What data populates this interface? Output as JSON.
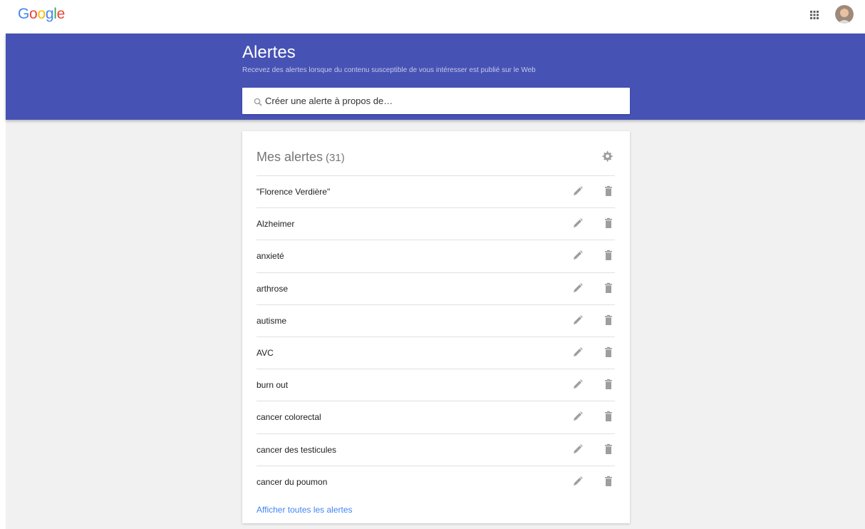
{
  "header": {
    "logo_letters": [
      "G",
      "o",
      "o",
      "g",
      "l",
      "e"
    ],
    "apps_icon": "apps-grid-icon",
    "avatar_icon": "user-avatar"
  },
  "hero": {
    "title": "Alertes",
    "subtitle": "Recevez des alertes lorsque du contenu susceptible de vous intéresser est publié sur le Web",
    "color": "#4652b4"
  },
  "search": {
    "placeholder": "Créer une alerte à propos de…"
  },
  "alerts": {
    "heading": "Mes alertes",
    "count": "(31)",
    "items": [
      {
        "label": "\"Florence Verdière\""
      },
      {
        "label": "Alzheimer"
      },
      {
        "label": "anxieté"
      },
      {
        "label": "arthrose"
      },
      {
        "label": "autisme"
      },
      {
        "label": "AVC"
      },
      {
        "label": "burn out"
      },
      {
        "label": "cancer colorectal"
      },
      {
        "label": "cancer des testicules"
      },
      {
        "label": "cancer du poumon"
      }
    ],
    "show_all": "Afficher toutes les alertes"
  }
}
